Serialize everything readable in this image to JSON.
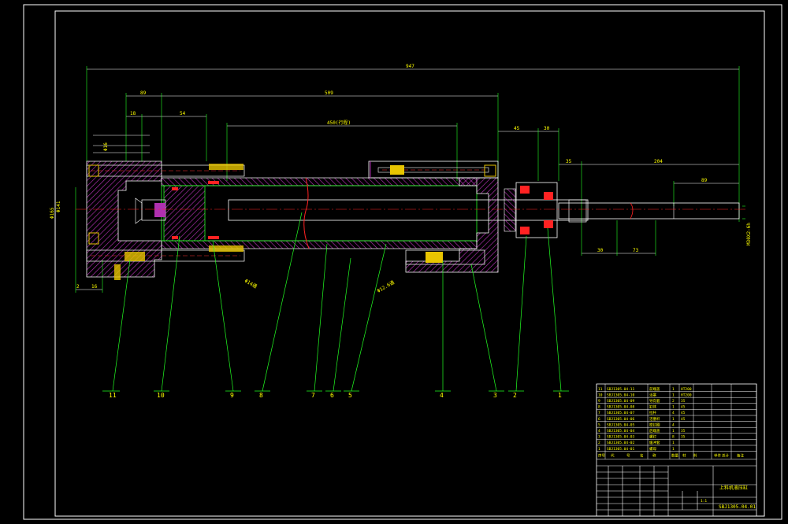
{
  "dimensions": {
    "overall": "947",
    "d89": "89",
    "d509": "509",
    "d18": "18",
    "d54": "54",
    "stroke": "450(行程)",
    "d45": "45",
    "d30": "30",
    "d35": "35",
    "d204": "204",
    "d89b": "89",
    "d30b": "30",
    "d73": "73",
    "d2": "2",
    "d16": "16",
    "dia141": "Φ141",
    "dia165": "Φ165",
    "phi16": "Φ16",
    "phi14": "Φ14通",
    "phi12": "Φ12.6通",
    "thread": "M30X2-6h"
  },
  "part_numbers": [
    "11",
    "10",
    "9",
    "8",
    "7",
    "6",
    "5",
    "4",
    "3",
    "2",
    "1"
  ],
  "bom": {
    "rows": [
      {
        "no": "11",
        "code": "SBJ1305.04-11",
        "name": "前端盖",
        "qty": "1",
        "mat": "HT200",
        "note": ""
      },
      {
        "no": "10",
        "code": "SBJ1305.04-10",
        "name": "活塞",
        "qty": "1",
        "mat": "HT200",
        "note": ""
      },
      {
        "no": "9",
        "code": "SBJ1305.04-09",
        "name": "导向套",
        "qty": "2",
        "mat": "35",
        "note": ""
      },
      {
        "no": "8",
        "code": "SBJ1305.04-08",
        "name": "缸体",
        "qty": "1",
        "mat": "45",
        "note": ""
      },
      {
        "no": "7",
        "code": "SBJ1305.04-07",
        "name": "拉杆",
        "qty": "4",
        "mat": "45",
        "note": ""
      },
      {
        "no": "6",
        "code": "SBJ1305.04-06",
        "name": "活塞杆",
        "qty": "1",
        "mat": "45",
        "note": ""
      },
      {
        "no": "5",
        "code": "SBJ1305.04-05",
        "name": "密封圈",
        "qty": "4",
        "mat": "",
        "note": ""
      },
      {
        "no": "4",
        "code": "SBJ1305.04-04",
        "name": "后端盖",
        "qty": "1",
        "mat": "35",
        "note": ""
      },
      {
        "no": "3",
        "code": "SBJ1305.04-03",
        "name": "螺钉",
        "qty": "8",
        "mat": "35",
        "note": ""
      },
      {
        "no": "2",
        "code": "SBJ1305.04-02",
        "name": "缓冲套",
        "qty": "1",
        "mat": "",
        "note": ""
      },
      {
        "no": "1",
        "code": "SBJ1305.04-01",
        "name": "螺母",
        "qty": "1",
        "mat": "",
        "note": ""
      }
    ],
    "header": [
      "序号",
      "代",
      "号",
      "名",
      "称",
      "数量",
      "材",
      "料",
      "单件",
      "总计",
      "备注"
    ]
  },
  "title_block": {
    "drawing_name": "上料机液压缸",
    "drawing_no": "SBJ1305.04.01",
    "scale": "1:1"
  }
}
